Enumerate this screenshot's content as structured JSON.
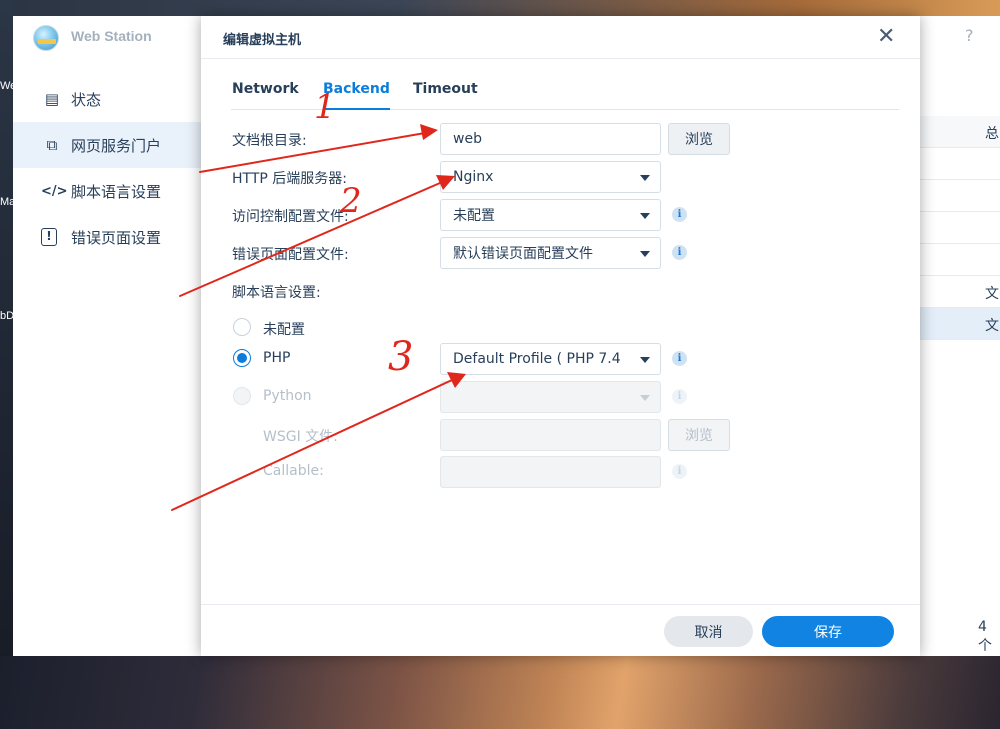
{
  "desktop": {
    "left_labels": [
      "We",
      "Ma",
      "bD"
    ]
  },
  "app": {
    "title": "Web Station",
    "help_glyph": "?",
    "sidebar": [
      {
        "label": "状态",
        "icon": "status-list-icon",
        "glyph": "▤"
      },
      {
        "label": "网页服务门户",
        "icon": "web-portal-icon",
        "glyph": "⧉"
      },
      {
        "label": "脚本语言设置",
        "icon": "code-icon",
        "glyph": "</>"
      },
      {
        "label": "错误页面设置",
        "icon": "error-page-icon",
        "glyph": "!"
      }
    ],
    "grid": {
      "header_text": "总",
      "row_text_1": "文",
      "row_text_2": "文",
      "footer_text": "4 个"
    }
  },
  "dialog": {
    "title": "编辑虚拟主机",
    "close_glyph": "✕",
    "tabs": [
      {
        "label": "Network",
        "active": false
      },
      {
        "label": "Backend",
        "active": true
      },
      {
        "label": "Timeout",
        "active": false
      }
    ],
    "form": {
      "doc_root_label": "文档根目录:",
      "doc_root_value": "web",
      "browse_label": "浏览",
      "http_backend_label": "HTTP 后端服务器:",
      "http_backend_value": "Nginx",
      "access_ctrl_label": "访问控制配置文件:",
      "access_ctrl_value": "未配置",
      "error_page_label": "错误页面配置文件:",
      "error_page_value": "默认错误页面配置文件",
      "script_lang_label": "脚本语言设置:",
      "radio_none_label": "未配置",
      "radio_php_label": "PHP",
      "php_profile_value": "Default Profile ( PHP 7.4",
      "radio_python_label": "Python",
      "python_value": "",
      "wsgi_label": "WSGI 文件:",
      "wsgi_value": "",
      "wsgi_browse_label": "浏览",
      "callable_label": "Callable:",
      "callable_value": "",
      "selected_script_language": "PHP"
    },
    "footer": {
      "cancel_label": "取消",
      "save_label": "保存"
    }
  },
  "annotations": {
    "color": "#e0271c",
    "number_1": "1",
    "number_2": "2",
    "number_3": "3"
  },
  "colors": {
    "accent": "#0c7dda",
    "save_button": "#1083e3",
    "sidebar_active": "#e9f1fa"
  }
}
